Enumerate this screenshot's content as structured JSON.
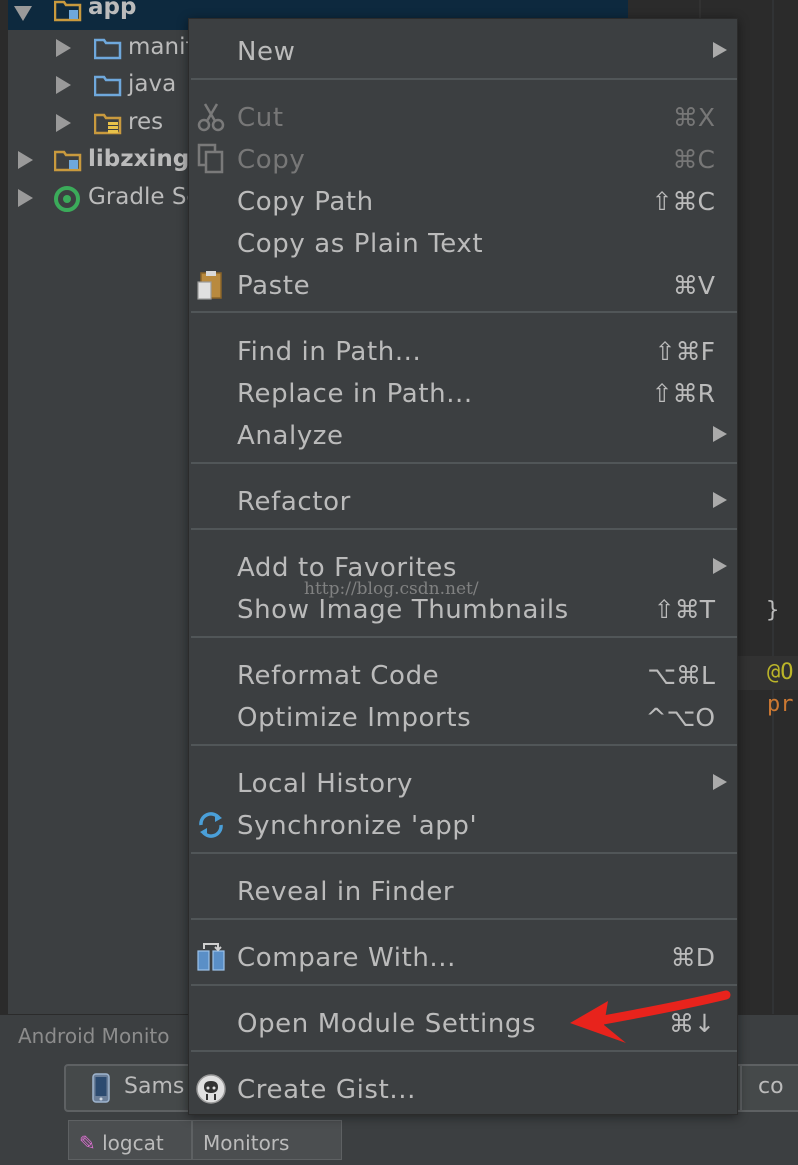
{
  "project_tree": {
    "rows": [
      {
        "label": "app",
        "expanded": true,
        "bold": true,
        "selected": true
      },
      {
        "label": "manifests",
        "visible_label": "manif",
        "expanded": false
      },
      {
        "label": "java",
        "expanded": false
      },
      {
        "label": "res",
        "expanded": false
      },
      {
        "label": "libzxing",
        "expanded": false,
        "bold": true
      },
      {
        "label": "Gradle Scripts",
        "visible_label": "Gradle Scr",
        "expanded": false
      }
    ]
  },
  "editor": {
    "brace": "}",
    "annotation_fragment": "@O",
    "keyword_fragment": "pr"
  },
  "monitor": {
    "title": "Android Monito",
    "device_label": "Sams",
    "right_field": "co",
    "tabs": [
      "logcat",
      "Monitors"
    ]
  },
  "watermark": "http://blog.csdn.net/",
  "context_menu": {
    "items": [
      {
        "label": "New",
        "shortcut": "",
        "submenu": true,
        "icon": ""
      },
      {
        "label": "Cut",
        "shortcut": "⌘X",
        "disabled": true,
        "icon": "scissors-icon"
      },
      {
        "label": "Copy",
        "shortcut": "⌘C",
        "disabled": true,
        "icon": "copy-icon"
      },
      {
        "label": "Copy Path",
        "shortcut": "⇧⌘C"
      },
      {
        "label": "Copy as Plain Text",
        "shortcut": ""
      },
      {
        "label": "Paste",
        "shortcut": "⌘V",
        "icon": "paste-icon"
      },
      {
        "label": "Find in Path...",
        "shortcut": "⇧⌘F"
      },
      {
        "label": "Replace in Path...",
        "shortcut": "⇧⌘R"
      },
      {
        "label": "Analyze",
        "submenu": true
      },
      {
        "label": "Refactor",
        "submenu": true
      },
      {
        "label": "Add to Favorites",
        "submenu": true
      },
      {
        "label": "Show Image Thumbnails",
        "shortcut": "⇧⌘T"
      },
      {
        "label": "Reformat Code",
        "shortcut": "⌥⌘L"
      },
      {
        "label": "Optimize Imports",
        "shortcut": "^⌥O"
      },
      {
        "label": "Local History",
        "submenu": true
      },
      {
        "label": "Synchronize 'app'",
        "icon": "sync-icon"
      },
      {
        "label": "Reveal in Finder"
      },
      {
        "label": "Compare With...",
        "shortcut": "⌘D",
        "icon": "compare-icon"
      },
      {
        "label": "Open Module Settings",
        "shortcut": "⌘↓"
      },
      {
        "label": "Create Gist...",
        "icon": "github-icon"
      }
    ]
  },
  "colors": {
    "menu_bg": "#3c3f41",
    "menu_text": "#bbbbbb",
    "disabled_text": "#777777",
    "selection": "#0d293e",
    "annotation_arrow": "#e8231c",
    "folder_blue": "#6fa8dc",
    "folder_orange": "#c99a3e"
  }
}
